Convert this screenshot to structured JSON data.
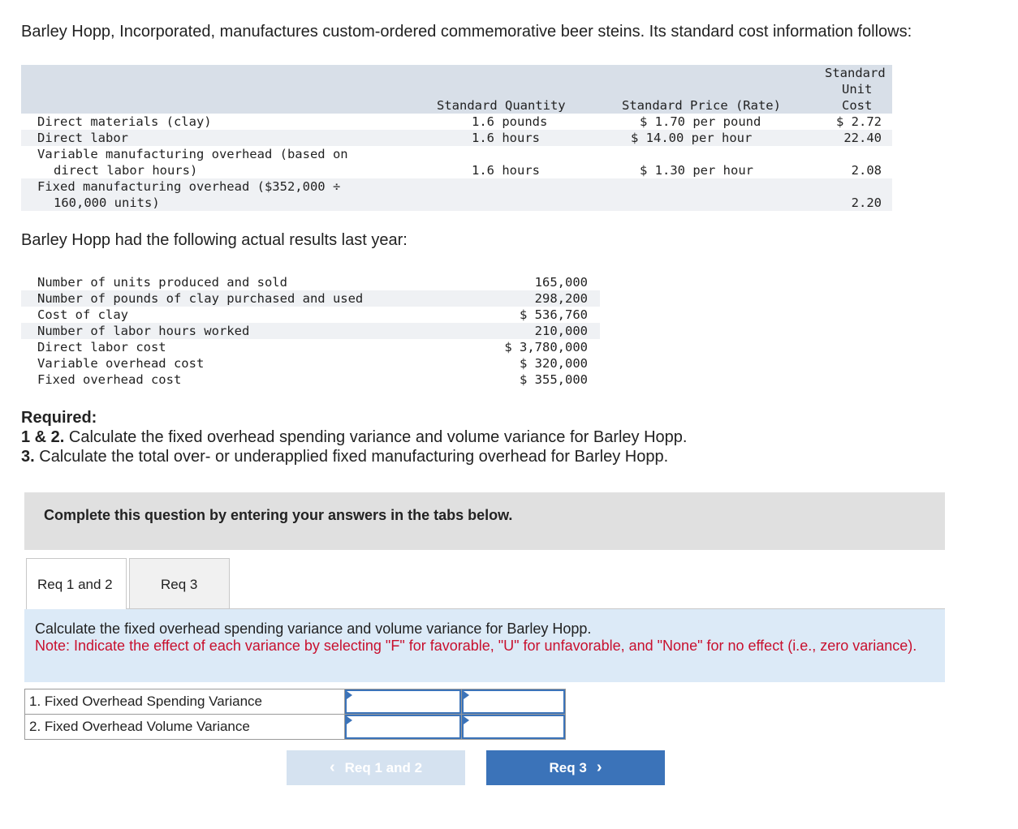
{
  "intro": "Barley Hopp, Incorporated, manufactures custom-ordered commemorative beer steins. Its standard cost information follows:",
  "standard_table": {
    "headers": {
      "quantity": "Standard Quantity",
      "price": "Standard Price (Rate)",
      "unit_cost_line1": "Standard",
      "unit_cost_line2": "Unit",
      "unit_cost_line3": "Cost"
    },
    "rows": [
      {
        "label": "Direct materials (clay)",
        "quantity": "1.6 pounds",
        "price": "$ 1.70 per pound",
        "cost": "$ 2.72"
      },
      {
        "label": "Direct labor",
        "quantity": "1.6 hours",
        "price": "$ 14.00 per hour",
        "cost": "22.40"
      },
      {
        "label_line1": "Variable manufacturing overhead (based on",
        "label_line2": "direct labor hours)",
        "quantity": "1.6 hours",
        "price": "$ 1.30 per hour",
        "cost": "2.08"
      },
      {
        "label_line1": "Fixed manufacturing overhead ($352,000 ÷",
        "label_line2": "160,000 units)",
        "quantity": "",
        "price": "",
        "cost": "2.20"
      }
    ]
  },
  "actual_title": "Barley Hopp had the following actual results last year:",
  "actual_table": [
    {
      "label": "Number of units produced and sold",
      "value": "165,000"
    },
    {
      "label": "Number of pounds of clay purchased and used",
      "value": "298,200"
    },
    {
      "label": "Cost of clay",
      "value": "$ 536,760"
    },
    {
      "label": "Number of labor hours worked",
      "value": "210,000"
    },
    {
      "label": "Direct labor cost",
      "value": "$ 3,780,000"
    },
    {
      "label": "Variable overhead cost",
      "value": "$ 320,000"
    },
    {
      "label": "Fixed overhead cost",
      "value": "$ 355,000"
    }
  ],
  "required": {
    "title": "Required:",
    "items": [
      {
        "num": "1 & 2.",
        "text": " Calculate the fixed overhead spending variance and volume variance for Barley Hopp."
      },
      {
        "num": "3.",
        "text": " Calculate the total over- or underapplied fixed manufacturing overhead for Barley Hopp."
      }
    ]
  },
  "complete_prompt": "Complete this question by entering your answers in the tabs below.",
  "tabs": [
    {
      "label": "Req 1 and 2",
      "active": true
    },
    {
      "label": "Req 3",
      "active": false
    }
  ],
  "instructions": {
    "main": "Calculate the fixed overhead spending variance and volume variance for Barley Hopp.",
    "note": "Note: Indicate the effect of each variance by selecting \"F\" for favorable, \"U\" for unfavorable, and \"None\" for no effect (i.e., zero variance)."
  },
  "answer_rows": [
    {
      "label": "1. Fixed Overhead Spending Variance",
      "amount": "",
      "effect": ""
    },
    {
      "label": "2. Fixed Overhead Volume Variance",
      "amount": "",
      "effect": ""
    }
  ],
  "nav": {
    "prev_label": "Req 1 and 2",
    "next_label": "Req 3",
    "prev_icon": "chevron-left-icon",
    "next_icon": "chevron-right-icon"
  },
  "colors": {
    "accent": "#3b73b9",
    "note_red": "#c8102e",
    "header_gray": "#d8dfe8",
    "instruction_bg": "#dceaf7"
  }
}
